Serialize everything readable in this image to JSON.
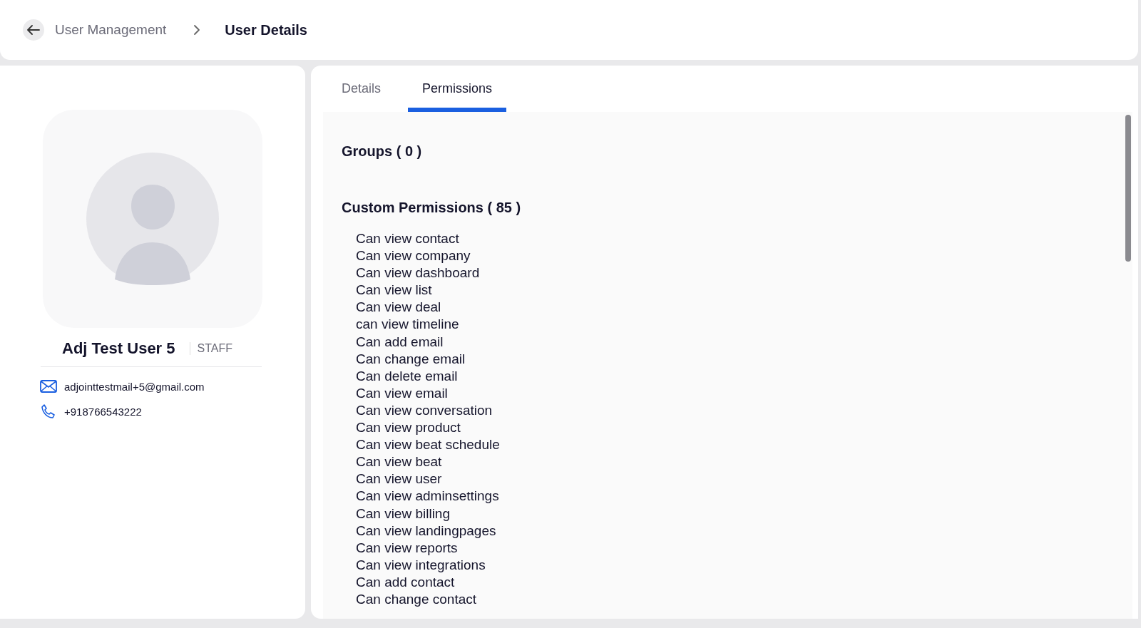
{
  "breadcrumb": [
    "User Management",
    "User Details"
  ],
  "profile": {
    "name": "Adj Test User 5",
    "role": "STAFF",
    "email": "adjointtestmail+5@gmail.com",
    "phone": "+918766543222"
  },
  "tabs": [
    {
      "label": "Details",
      "selected": false
    },
    {
      "label": "Permissions",
      "selected": true
    }
  ],
  "groups_heading": "Groups ( 0 )",
  "custom_permissions_heading": "Custom Permissions ( 85 )",
  "permissions": [
    "Can view contact",
    "Can view company",
    "Can view dashboard",
    "Can view list",
    "Can view deal",
    "can view timeline",
    "Can add email",
    "Can change email",
    "Can delete email",
    "Can view email",
    "Can view conversation",
    "Can view product",
    "Can view beat schedule",
    "Can view beat",
    "Can view user",
    "Can view adminsettings",
    "Can view billing",
    "Can view landingpages",
    "Can view reports",
    "Can view integrations",
    "Can add contact",
    "Can change contact"
  ]
}
